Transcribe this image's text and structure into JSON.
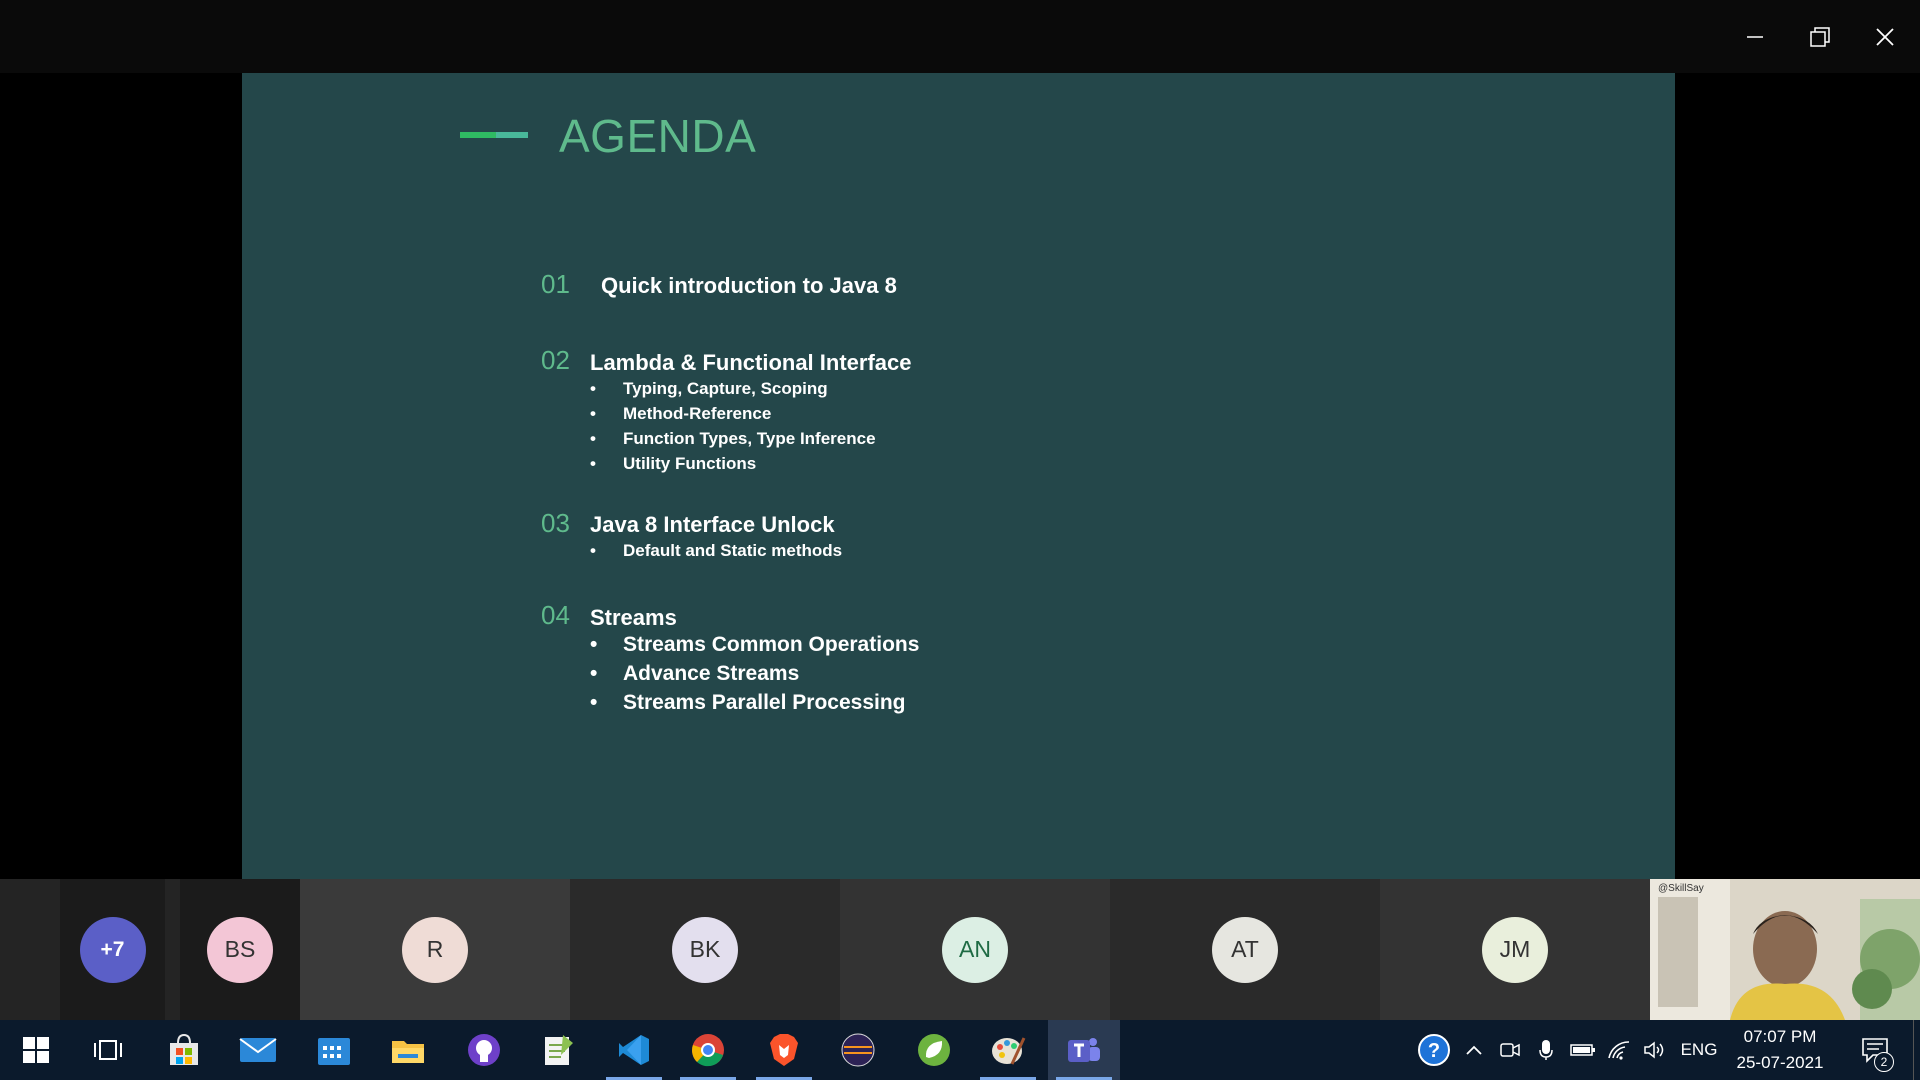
{
  "slide": {
    "title": "AGENDA",
    "items": [
      {
        "num": "01",
        "heading": "Quick introduction to Java 8",
        "bullets": []
      },
      {
        "num": "02",
        "heading": "Lambda & Functional Interface",
        "bullets": [
          "Typing, Capture, Scoping",
          "Method-Reference",
          "Function Types, Type Inference",
          "Utility Functions"
        ]
      },
      {
        "num": "03",
        "heading": "Java 8 Interface Unlock",
        "bullets": [
          "Default and Static methods"
        ]
      },
      {
        "num": "04",
        "heading": "Streams",
        "bullets": [
          "Streams Common Operations",
          "Advance Streams",
          "Streams Parallel Processing"
        ]
      }
    ]
  },
  "participants": {
    "overflow": "+7",
    "initials": [
      "BS",
      "R",
      "BK",
      "AN",
      "AT",
      "JM"
    ],
    "video_label": "@SkillSay"
  },
  "taskbar": {
    "language": "ENG",
    "time": "07:07 PM",
    "date": "25-07-2021",
    "notification_count": "2"
  },
  "colors": {
    "slide_bg": "#24474a",
    "accent_green": "#5fba8c",
    "teams_purple": "#5b5fc7"
  }
}
